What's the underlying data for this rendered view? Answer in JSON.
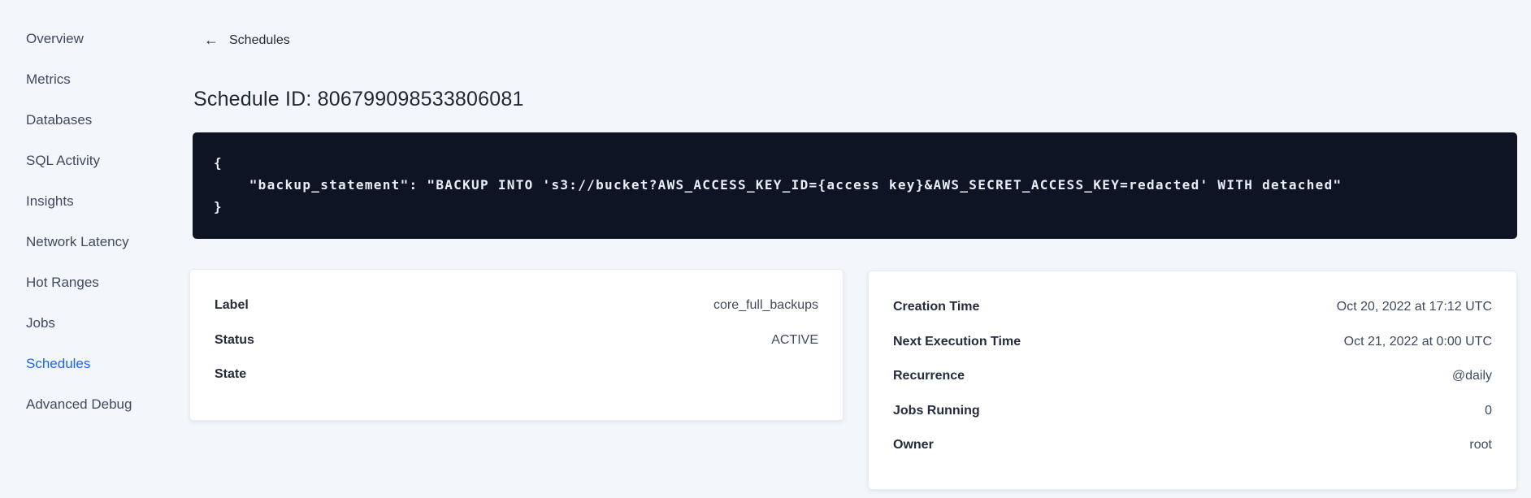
{
  "colors": {
    "page_bg": "#f3f6fa",
    "accent_blue": "#1a66f0",
    "code_bg": "#0e1423",
    "code_text": "#e9eef6",
    "text_dark": "#242a35"
  },
  "sidebar": {
    "items": [
      {
        "label": "Overview",
        "active": false
      },
      {
        "label": "Metrics",
        "active": false
      },
      {
        "label": "Databases",
        "active": false
      },
      {
        "label": "SQL Activity",
        "active": false
      },
      {
        "label": "Insights",
        "active": false
      },
      {
        "label": "Network Latency",
        "active": false
      },
      {
        "label": "Hot Ranges",
        "active": false
      },
      {
        "label": "Jobs",
        "active": false
      },
      {
        "label": "Schedules",
        "active": true
      },
      {
        "label": "Advanced Debug",
        "active": false
      }
    ]
  },
  "header": {
    "back_label": "Schedules",
    "back_arrow_glyph": "←",
    "title": "Schedule ID: 806799098533806081"
  },
  "code_block": {
    "lines": [
      "{",
      "    \"backup_statement\": \"BACKUP INTO 's3://bucket?AWS_ACCESS_KEY_ID={access key}&AWS_SECRET_ACCESS_KEY=redacted' WITH detached\"",
      "}"
    ]
  },
  "details_left": {
    "rows": [
      {
        "label": "Label",
        "value": "core_full_backups"
      },
      {
        "label": "Status",
        "value": "ACTIVE"
      },
      {
        "label": "State",
        "value": ""
      }
    ]
  },
  "details_right": {
    "rows": [
      {
        "label": "Creation Time",
        "value": "Oct 20, 2022 at 17:12 UTC"
      },
      {
        "label": "Next Execution Time",
        "value": "Oct 21, 2022 at 0:00 UTC"
      },
      {
        "label": "Recurrence",
        "value": "@daily"
      },
      {
        "label": "Jobs Running",
        "value": "0"
      },
      {
        "label": "Owner",
        "value": "root"
      }
    ]
  }
}
